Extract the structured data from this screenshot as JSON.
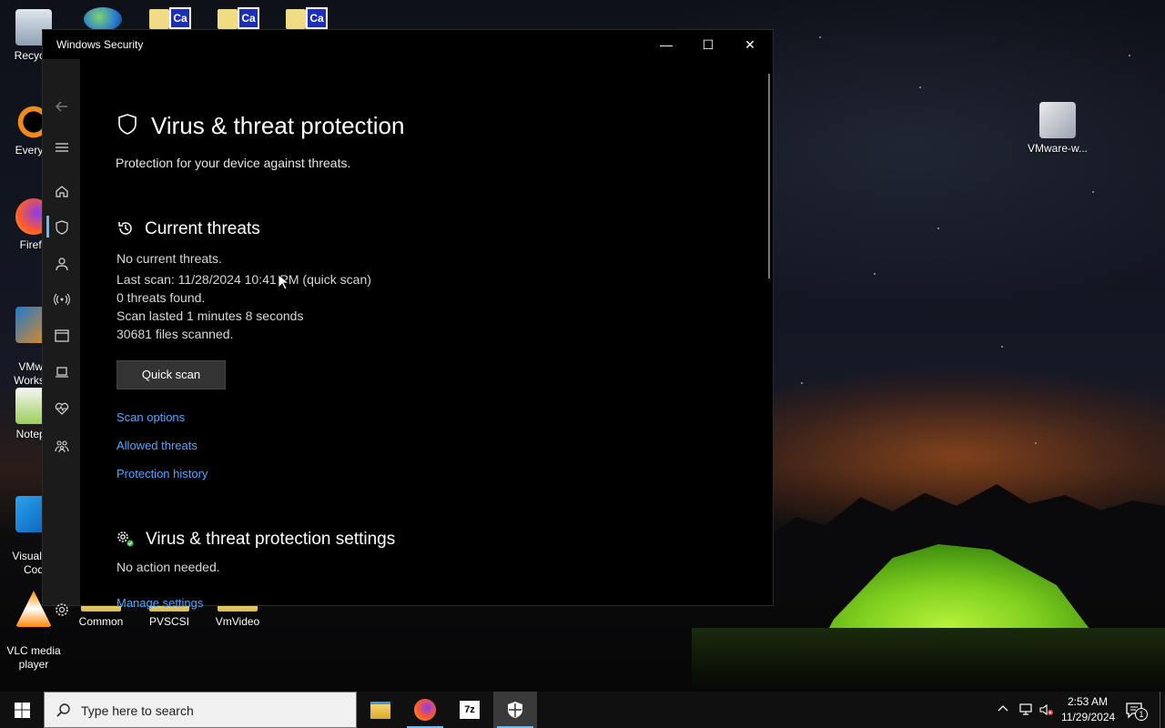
{
  "desktop": {
    "left_icons": [
      {
        "label": "Recycle",
        "icon": "recycle-bin-icon"
      },
      {
        "label": "Everyth",
        "icon": "everything-search-icon"
      },
      {
        "label": "Firefo",
        "icon": "firefox-icon"
      },
      {
        "label": "VMwa\nWorksta",
        "icon": "vmware-workstation-icon"
      },
      {
        "label": "Notepa",
        "icon": "notepad-plus-icon"
      },
      {
        "label": "Visual St\nCod",
        "icon": "vscode-icon"
      },
      {
        "label": "VLC media\nplayer",
        "icon": "vlc-icon"
      }
    ],
    "bottom_folders": [
      {
        "label": "Common"
      },
      {
        "label": "PVSCSI"
      },
      {
        "label": "VmVideo"
      }
    ],
    "top_folder_badge": "Ca",
    "right_icons": [
      {
        "label": "VMware-w...",
        "icon": "vmware-tools-installer-icon"
      }
    ]
  },
  "window": {
    "title": "Windows Security",
    "controls": {
      "minimize": "—",
      "maximize": "☐",
      "close": "✕"
    }
  },
  "page": {
    "title": "Virus & threat protection",
    "subtitle": "Protection for your device against threats.",
    "current_threats": {
      "heading": "Current threats",
      "status": "No current threats.",
      "last_scan": "Last scan: 11/28/2024 10:41 PM (quick scan)",
      "threats_found": "0 threats found.",
      "scan_duration": "Scan lasted 1 minutes 8 seconds",
      "files_scanned": "30681 files scanned.",
      "quick_scan_button": "Quick scan",
      "links": {
        "scan_options": "Scan options",
        "allowed_threats": "Allowed threats",
        "protection_history": "Protection history"
      }
    },
    "settings": {
      "heading": "Virus & threat protection settings",
      "status": "No action needed.",
      "manage_link": "Manage settings"
    }
  },
  "taskbar": {
    "search_placeholder": "Type here to search",
    "time": "2:53 AM",
    "date": "11/29/2024",
    "notification_count": "1"
  },
  "colors": {
    "accent": "#4ea6ff",
    "window_bg": "#000000",
    "nav_bg": "#1b1b1b",
    "taskbar_bg": "#101010"
  }
}
